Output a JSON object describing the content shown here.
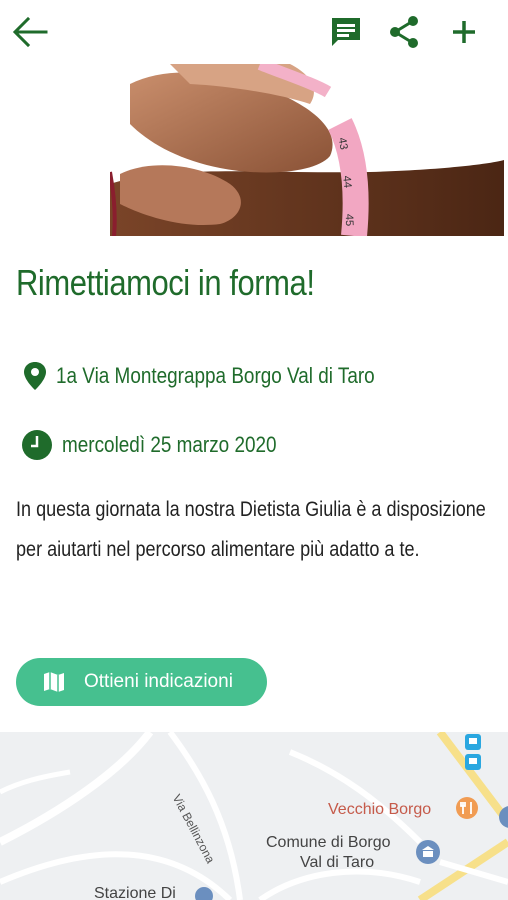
{
  "header": {
    "icons": [
      "arrow-back-icon",
      "chat-icon",
      "share-icon",
      "plus-icon"
    ],
    "accent": "#1f6b2b"
  },
  "event": {
    "title": "Rimettiamoci in forma!",
    "location": "1a Via Montegrappa Borgo Val di Taro",
    "date": "mercoledì 25 marzo 2020",
    "description": "In questa giornata la nostra Dietista Giulia è a disposizione per aiutarti nel percorso alimentare più adatto a te."
  },
  "directions": {
    "label": "Ottieni indicazioni",
    "color": "#46c08f"
  },
  "map": {
    "street": "Via Bellinzona",
    "poi_restaurant": "Vecchio Borgo",
    "poi_town_hall_line1": "Comune di Borgo",
    "poi_town_hall_line2": "Val di Taro",
    "poi_station": "Stazione Di"
  }
}
